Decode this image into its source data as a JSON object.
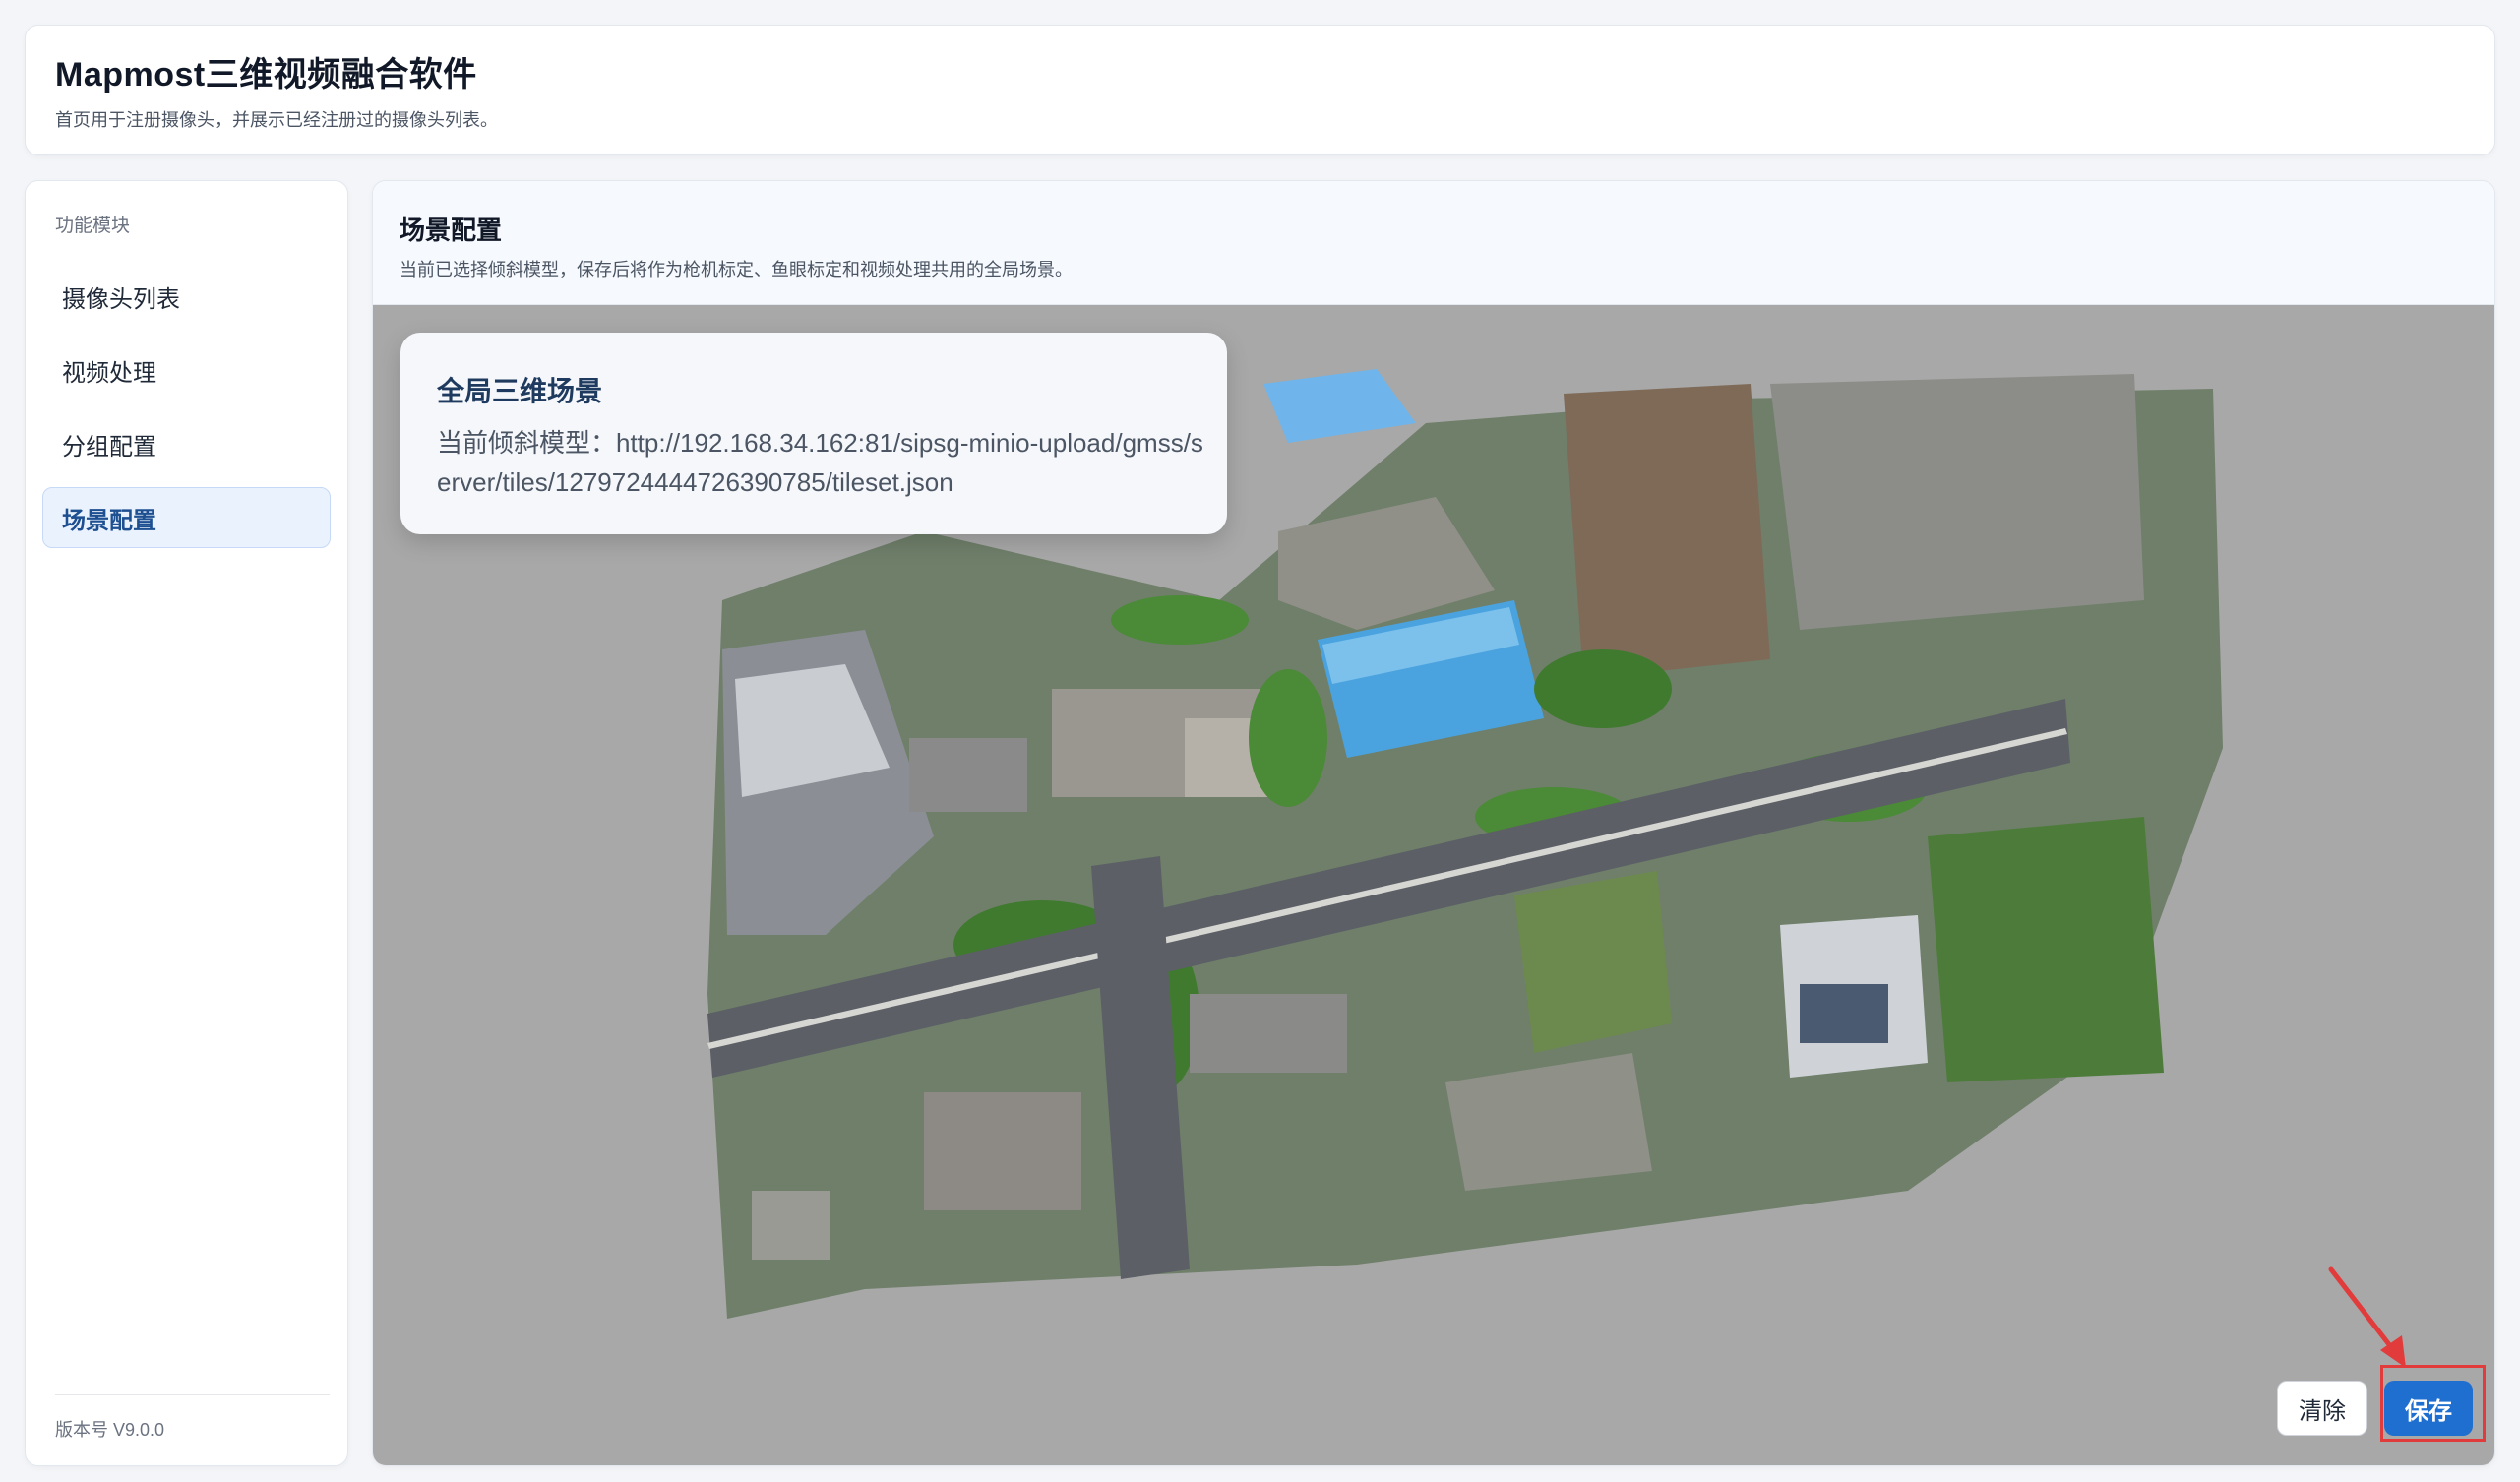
{
  "header": {
    "title": "Mapmost三维视频融合软件",
    "subtitle": "首页用于注册摄像头，并展示已经注册过的摄像头列表。"
  },
  "sidebar": {
    "heading": "功能模块",
    "items": [
      {
        "label": "摄像头列表"
      },
      {
        "label": "视频处理"
      },
      {
        "label": "分组配置"
      },
      {
        "label": "场景配置",
        "active": true
      }
    ],
    "version": "版本号 V9.0.0"
  },
  "main": {
    "title": "场景配置",
    "subtitle": "当前已选择倾斜模型，保存后将作为枪机标定、鱼眼标定和视频处理共用的全局场景。",
    "card": {
      "title": "全局三维场景",
      "text": "当前倾斜模型：http://192.168.34.162:81/sipsg-minio-upload/gmss/server/tiles/1279724444726390785/tileset.json"
    },
    "buttons": {
      "clear": "清除",
      "save": "保存"
    }
  },
  "colors": {
    "accent": "#1f6fd1",
    "annotation": "#e23b3b",
    "scene_background": "#a8a8a8"
  }
}
